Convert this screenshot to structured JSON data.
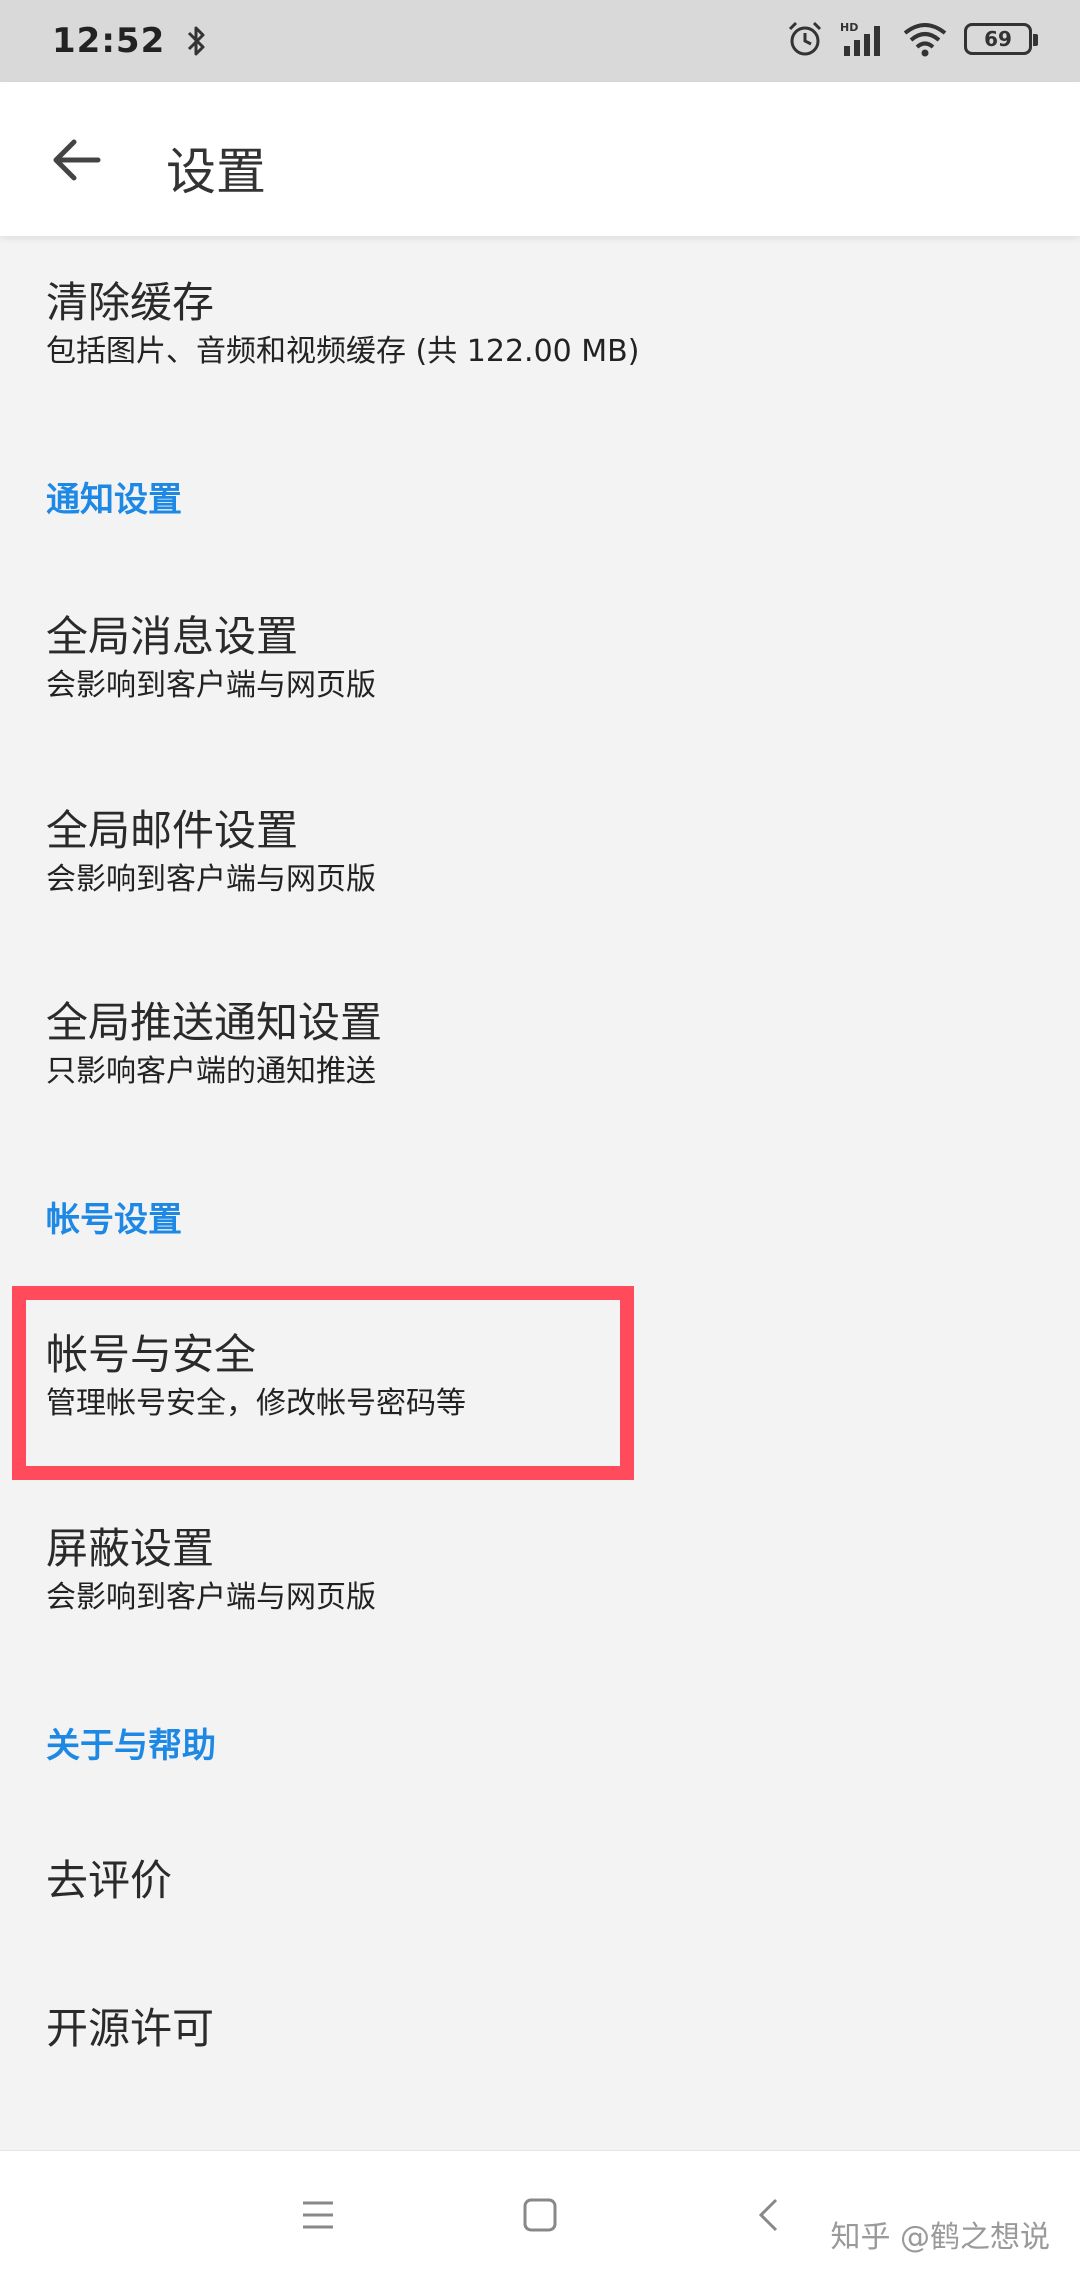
{
  "status_bar": {
    "time": "12:52",
    "battery": "69",
    "network_label": "HD",
    "icons": [
      "bluetooth-icon",
      "alarm-icon",
      "hd-signal-icon",
      "wifi-icon",
      "battery-icon"
    ]
  },
  "header": {
    "title": "设置",
    "back_icon": "arrow-left-icon"
  },
  "items": {
    "clear_cache": {
      "title": "清除缓存",
      "subtitle": "包括图片、音频和视频缓存 (共 122.00 MB)"
    },
    "section_notify": "通知设置",
    "global_message": {
      "title": "全局消息设置",
      "subtitle": "会影响到客户端与网页版"
    },
    "global_mail": {
      "title": "全局邮件设置",
      "subtitle": "会影响到客户端与网页版"
    },
    "global_push": {
      "title": "全局推送通知设置",
      "subtitle": "只影响客户端的通知推送"
    },
    "section_account": "帐号设置",
    "account_security": {
      "title": "帐号与安全",
      "subtitle": "管理帐号安全，修改帐号密码等"
    },
    "block": {
      "title": "屏蔽设置",
      "subtitle": "会影响到客户端与网页版"
    },
    "section_about": "关于与帮助",
    "rate": {
      "title": "去评价"
    },
    "license": {
      "title": "开源许可"
    }
  },
  "nav_bar": {
    "icons": [
      "menu-icon",
      "home-square-icon",
      "back-chevron-icon"
    ]
  },
  "watermark": "知乎 @鹤之想说",
  "colors": {
    "accent": "#1e88e5",
    "highlight": "#ff4b5b",
    "background": "#f3f3f3"
  }
}
